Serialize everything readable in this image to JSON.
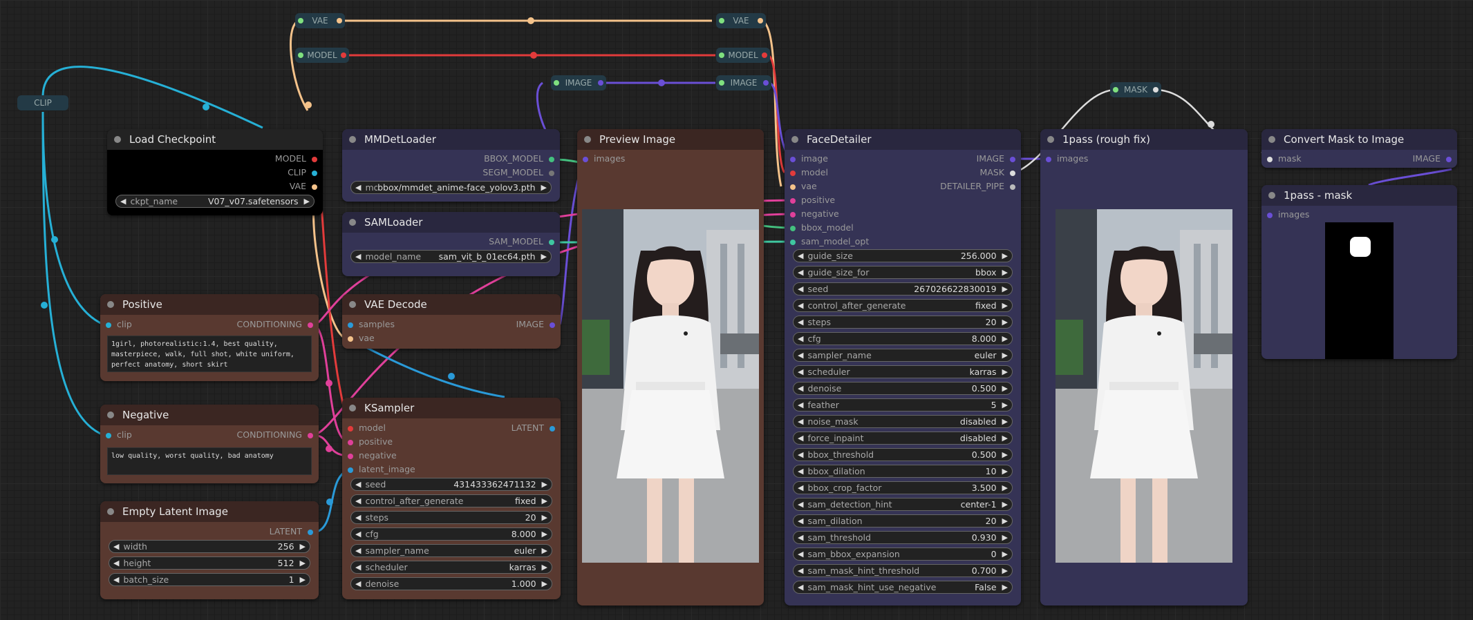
{
  "colors": {
    "clip": "#26b0d6",
    "model": "#e23b3b",
    "vae": "#f4c28a",
    "conditioning": "#e0409a",
    "latent": "#2a9ad8",
    "image": "#6a4fd6",
    "mask": "#7fe07f",
    "bbox": "#44c07f",
    "sam": "#3fc7a0",
    "node_brown": "#593930",
    "node_brown_title": "#3b2622",
    "node_blue": "#353355",
    "node_blue_title": "#29273f",
    "node_black": "#000000",
    "node_black_title": "#232323"
  },
  "reroutes": {
    "clip": "CLIP",
    "vae": "VAE",
    "model": "MODEL",
    "image": "IMAGE",
    "mask": "MASK"
  },
  "load_checkpoint": {
    "title": "Load Checkpoint",
    "outputs": [
      "MODEL",
      "CLIP",
      "VAE"
    ],
    "ckpt": {
      "label": "ckpt_name",
      "value": "V07_v07.safetensors"
    }
  },
  "mmdet": {
    "title": "MMDetLoader",
    "outputs": [
      "BBOX_MODEL",
      "SEGM_MODEL"
    ],
    "model": {
      "label": "model_name",
      "value": "bbox/mmdet_anime-face_yolov3.pth"
    }
  },
  "sam": {
    "title": "SAMLoader",
    "output": "SAM_MODEL",
    "model": {
      "label": "model_name",
      "value": "sam_vit_b_01ec64.pth"
    }
  },
  "positive": {
    "title": "Positive",
    "input": "clip",
    "output": "CONDITIONING",
    "text": "1girl, photorealistic:1.4, best quality, masterpiece, walk, full shot, white uniform, perfect anatomy, short skirt"
  },
  "negative": {
    "title": "Negative",
    "input": "clip",
    "output": "CONDITIONING",
    "text": "low quality, worst quality, bad anatomy"
  },
  "vae_decode": {
    "title": "VAE Decode",
    "inputs": [
      "samples",
      "vae"
    ],
    "output": "IMAGE"
  },
  "ksampler": {
    "title": "KSampler",
    "inputs": [
      "model",
      "positive",
      "negative",
      "latent_image"
    ],
    "output": "LATENT",
    "widgets": [
      {
        "label": "seed",
        "value": "431433362471132"
      },
      {
        "label": "control_after_generate",
        "value": "fixed"
      },
      {
        "label": "steps",
        "value": "20"
      },
      {
        "label": "cfg",
        "value": "8.000"
      },
      {
        "label": "sampler_name",
        "value": "euler"
      },
      {
        "label": "scheduler",
        "value": "karras"
      },
      {
        "label": "denoise",
        "value": "1.000"
      }
    ]
  },
  "empty_latent": {
    "title": "Empty Latent Image",
    "output": "LATENT",
    "widgets": [
      {
        "label": "width",
        "value": "256"
      },
      {
        "label": "height",
        "value": "512"
      },
      {
        "label": "batch_size",
        "value": "1"
      }
    ]
  },
  "preview": {
    "title": "Preview Image",
    "input": "images"
  },
  "face_detailer": {
    "title": "FaceDetailer",
    "inputs": [
      "image",
      "model",
      "vae",
      "positive",
      "negative",
      "bbox_model",
      "sam_model_opt"
    ],
    "outputs": [
      "IMAGE",
      "MASK",
      "DETAILER_PIPE"
    ],
    "widgets": [
      {
        "label": "guide_size",
        "value": "256.000"
      },
      {
        "label": "guide_size_for",
        "value": "bbox"
      },
      {
        "label": "seed",
        "value": "267026622830019"
      },
      {
        "label": "control_after_generate",
        "value": "fixed"
      },
      {
        "label": "steps",
        "value": "20"
      },
      {
        "label": "cfg",
        "value": "8.000"
      },
      {
        "label": "sampler_name",
        "value": "euler"
      },
      {
        "label": "scheduler",
        "value": "karras"
      },
      {
        "label": "denoise",
        "value": "0.500"
      },
      {
        "label": "feather",
        "value": "5"
      },
      {
        "label": "noise_mask",
        "value": "disabled"
      },
      {
        "label": "force_inpaint",
        "value": "disabled"
      },
      {
        "label": "bbox_threshold",
        "value": "0.500"
      },
      {
        "label": "bbox_dilation",
        "value": "10"
      },
      {
        "label": "bbox_crop_factor",
        "value": "3.500"
      },
      {
        "label": "sam_detection_hint",
        "value": "center-1"
      },
      {
        "label": "sam_dilation",
        "value": "20"
      },
      {
        "label": "sam_threshold",
        "value": "0.930"
      },
      {
        "label": "sam_bbox_expansion",
        "value": "0"
      },
      {
        "label": "sam_mask_hint_threshold",
        "value": "0.700"
      },
      {
        "label": "sam_mask_hint_use_negative",
        "value": "False"
      }
    ]
  },
  "pass_fix": {
    "title": "1pass (rough fix)",
    "input": "images"
  },
  "convert_mask": {
    "title": "Convert Mask to Image",
    "input": "mask",
    "output": "IMAGE"
  },
  "pass_mask": {
    "title": "1pass - mask",
    "input": "images"
  }
}
